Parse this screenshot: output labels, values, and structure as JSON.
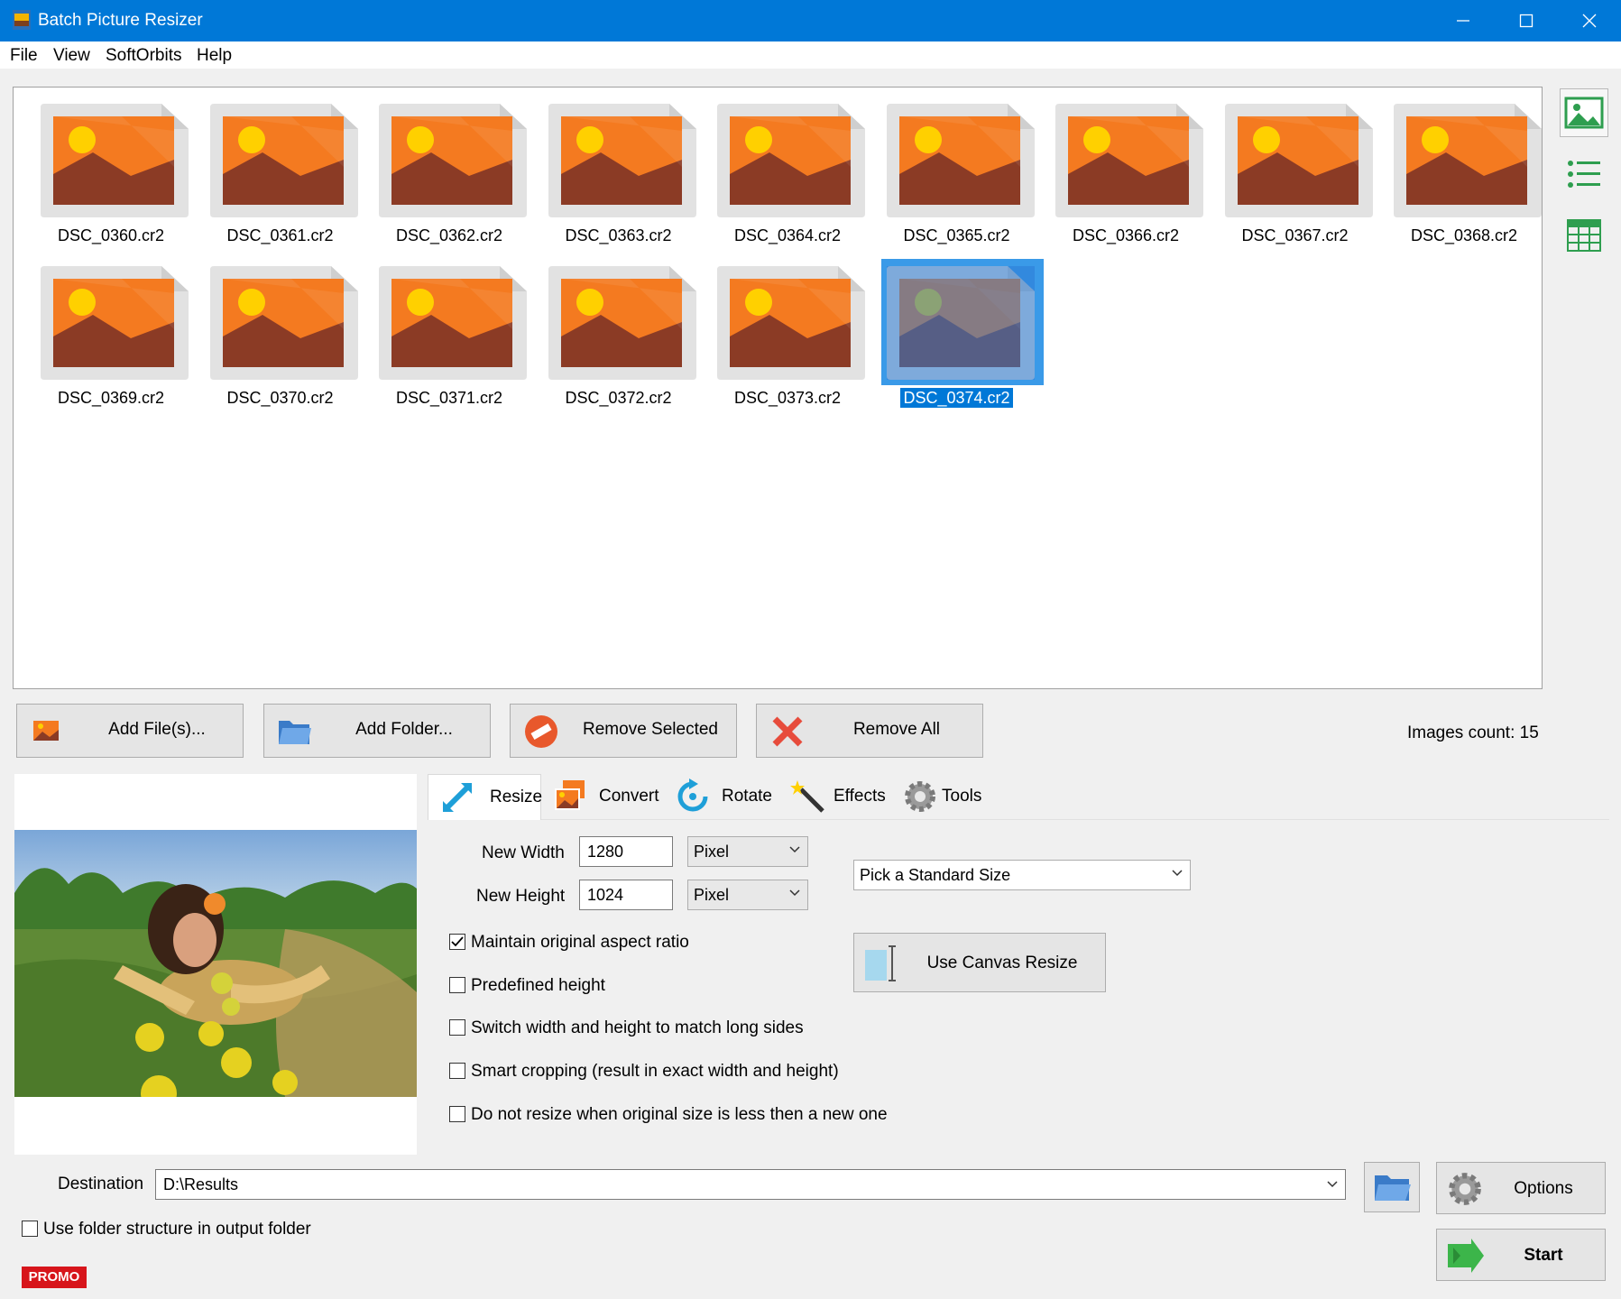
{
  "window": {
    "title": "Batch Picture Resizer"
  },
  "menu": {
    "items": [
      "File",
      "View",
      "SoftOrbits",
      "Help"
    ]
  },
  "files": [
    {
      "name": "DSC_0360.cr2",
      "selected": false
    },
    {
      "name": "DSC_0361.cr2",
      "selected": false
    },
    {
      "name": "DSC_0362.cr2",
      "selected": false
    },
    {
      "name": "DSC_0363.cr2",
      "selected": false
    },
    {
      "name": "DSC_0364.cr2",
      "selected": false
    },
    {
      "name": "DSC_0365.cr2",
      "selected": false
    },
    {
      "name": "DSC_0366.cr2",
      "selected": false
    },
    {
      "name": "DSC_0367.cr2",
      "selected": false
    },
    {
      "name": "DSC_0368.cr2",
      "selected": false
    },
    {
      "name": "DSC_0369.cr2",
      "selected": false
    },
    {
      "name": "DSC_0370.cr2",
      "selected": false
    },
    {
      "name": "DSC_0371.cr2",
      "selected": false
    },
    {
      "name": "DSC_0372.cr2",
      "selected": false
    },
    {
      "name": "DSC_0373.cr2",
      "selected": false
    },
    {
      "name": "DSC_0374.cr2",
      "selected": true
    }
  ],
  "view_buttons": [
    "thumbnails-view-icon",
    "list-view-icon",
    "details-view-icon"
  ],
  "actions": {
    "add_files": "Add File(s)...",
    "add_folder": "Add Folder...",
    "remove_selected": "Remove Selected",
    "remove_all": "Remove All"
  },
  "images_count": "Images count: 15",
  "tabs": [
    "Resize",
    "Convert",
    "Rotate",
    "Effects",
    "Tools"
  ],
  "active_tab": "Resize",
  "resize": {
    "new_width_label": "New Width",
    "new_width_value": "1280",
    "new_width_unit": "Pixel",
    "new_height_label": "New Height",
    "new_height_value": "1024",
    "new_height_unit": "Pixel",
    "standard_size": "Pick a Standard Size",
    "canvas_button": "Use Canvas Resize",
    "options": [
      {
        "label": "Maintain original aspect ratio",
        "checked": true
      },
      {
        "label": "Predefined height",
        "checked": false
      },
      {
        "label": "Switch width and height to match long sides",
        "checked": false
      },
      {
        "label": "Smart cropping (result in exact width and height)",
        "checked": false
      },
      {
        "label": "Do not resize when original size is less then a new one",
        "checked": false
      }
    ]
  },
  "destination": {
    "label": "Destination",
    "value": "D:\\Results",
    "use_folder_structure": "Use folder structure in output folder",
    "use_folder_structure_checked": false
  },
  "buttons": {
    "options": "Options",
    "start": "Start"
  },
  "promo": "PROMO",
  "colors": {
    "titlebar": "#0078d7",
    "selection": "#0078d7",
    "promo": "#d7151b",
    "thumb_orange": "#f47a20",
    "thumb_brown": "#8b3b25",
    "thumb_sun": "#ffd000"
  }
}
